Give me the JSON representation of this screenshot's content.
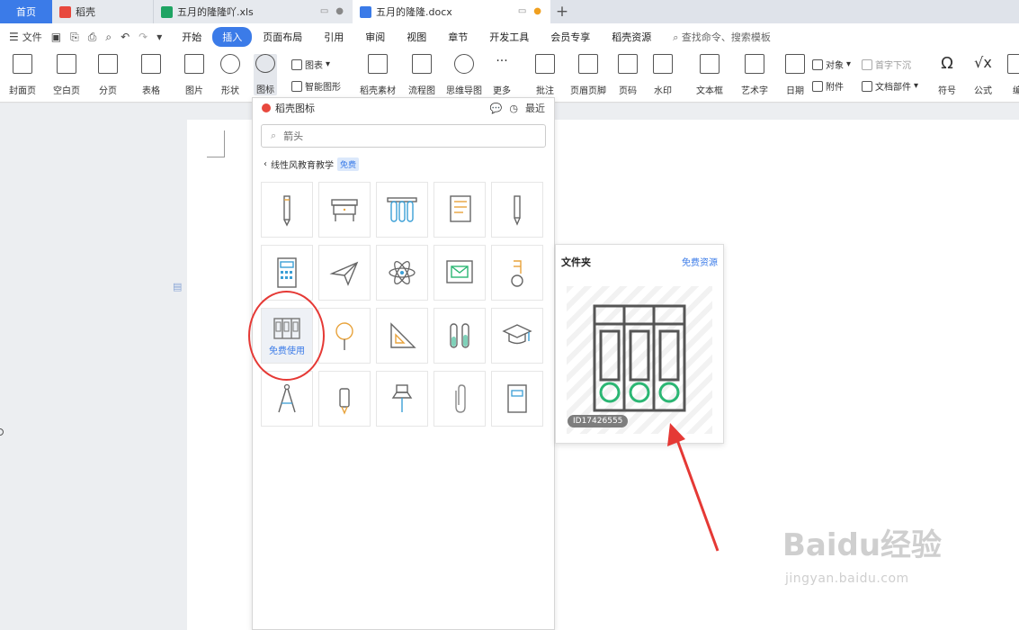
{
  "tabs": {
    "home": "首页",
    "daoke": "稻壳",
    "xls": "五月的隆隆吖.xls",
    "docx": "五月的隆隆.docx"
  },
  "menu": {
    "file": "文件",
    "items": [
      "开始",
      "插入",
      "页面布局",
      "引用",
      "审阅",
      "视图",
      "章节",
      "开发工具",
      "会员专享",
      "稻壳资源"
    ],
    "search": "查找命令、搜索模板"
  },
  "ribbon": {
    "cover": "封面页",
    "blank": "空白页",
    "pagebreak": "分页",
    "table": "表格",
    "picture": "图片",
    "shape": "形状",
    "icon": "图标",
    "chart": "图表",
    "smartart": "智能图形",
    "material": "稻壳素材",
    "flow": "流程图",
    "mind": "思维导图",
    "more": "更多",
    "comment": "批注",
    "header": "页眉页脚",
    "pagenum": "页码",
    "watermark": "水印",
    "textbox": "文本框",
    "wordart": "艺术字",
    "date": "日期",
    "object": "对象",
    "attach": "附件",
    "dropcap": "首字下沉",
    "docpart": "文档部件",
    "symbol": "符号",
    "formula": "公式",
    "edit": "编"
  },
  "panel": {
    "title": "稻壳图标",
    "recent": "最近",
    "search_value": "箭头",
    "crumb": "线性风教育教学",
    "badge": "免费",
    "free_use": "免费使用"
  },
  "preview": {
    "title": "文件夹",
    "link": "免费资源",
    "id": "ID17426555"
  },
  "watermark": {
    "brand": "Baidu经验",
    "url": "jingyan.baidu.com"
  },
  "colors": {
    "accent": "#3b7be8",
    "annotation": "#e53935"
  }
}
